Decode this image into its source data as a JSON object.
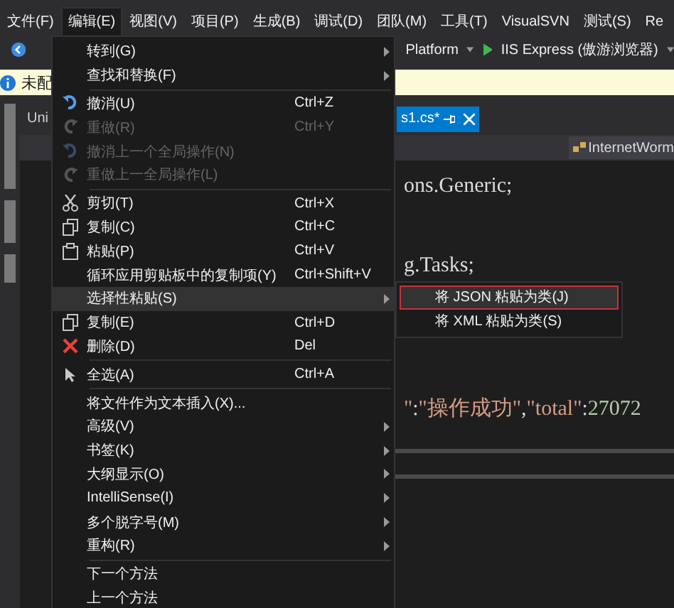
{
  "menu_bar": [
    {
      "label": "文件(F)",
      "selected": false
    },
    {
      "label": "编辑(E)",
      "selected": true
    },
    {
      "label": "视图(V)",
      "selected": false
    },
    {
      "label": "项目(P)",
      "selected": false
    },
    {
      "label": "生成(B)",
      "selected": false
    },
    {
      "label": "调试(D)",
      "selected": false
    },
    {
      "label": "团队(M)",
      "selected": false
    },
    {
      "label": "工具(T)",
      "selected": false
    },
    {
      "label": "VisualSVN",
      "selected": false
    },
    {
      "label": "测试(S)",
      "selected": false
    },
    {
      "label": "Re",
      "selected": false
    }
  ],
  "toolbar": {
    "platform": "Platform",
    "run_target": "IIS Express (傲游浏览器)"
  },
  "info_bar": {
    "text": "未配"
  },
  "tabs": [
    {
      "label": "Uni",
      "selected": false
    },
    {
      "label": "s1.cs*",
      "selected": true
    }
  ],
  "nav_bar": {
    "member": "InternetWorm"
  },
  "code_lines": [
    [
      {
        "kind": "plain",
        "text": "ons.Generic;"
      }
    ],
    [
      {
        "kind": "plain",
        "text": "g.Tasks;"
      }
    ],
    [
      {
        "kind": "string",
        "text": "\""
      },
      {
        "kind": "plain",
        "text": ":"
      },
      {
        "kind": "string",
        "text": "\"操作成功\""
      },
      {
        "kind": "plain",
        "text": ","
      },
      {
        "kind": "string",
        "text": "\"total\""
      },
      {
        "kind": "plain",
        "text": ":"
      },
      {
        "kind": "number",
        "text": "27072"
      }
    ]
  ],
  "edit_menu": [
    {
      "kind": "item",
      "label": "转到(G)",
      "submenu": true,
      "disabled": false,
      "selected": false
    },
    {
      "kind": "item",
      "label": "查找和替换(F)",
      "submenu": true,
      "disabled": false,
      "selected": false
    },
    {
      "kind": "separator"
    },
    {
      "kind": "item",
      "label": "撤消(U)",
      "shortcut": "Ctrl+Z",
      "submenu": false,
      "disabled": false,
      "selected": false
    },
    {
      "kind": "item",
      "label": "重做(R)",
      "shortcut": "Ctrl+Y",
      "submenu": false,
      "disabled": true,
      "selected": false
    },
    {
      "kind": "item",
      "label": "撤消上一个全局操作(N)",
      "submenu": false,
      "disabled": true,
      "selected": false
    },
    {
      "kind": "item",
      "label": "重做上一全局操作(L)",
      "submenu": false,
      "disabled": true,
      "selected": false
    },
    {
      "kind": "separator"
    },
    {
      "kind": "item",
      "label": "剪切(T)",
      "shortcut": "Ctrl+X",
      "submenu": false,
      "disabled": false,
      "selected": false
    },
    {
      "kind": "item",
      "label": "复制(C)",
      "shortcut": "Ctrl+C",
      "submenu": false,
      "disabled": false,
      "selected": false
    },
    {
      "kind": "item",
      "label": "粘贴(P)",
      "shortcut": "Ctrl+V",
      "submenu": false,
      "disabled": false,
      "selected": false
    },
    {
      "kind": "item",
      "label": "循环应用剪贴板中的复制项(Y)",
      "shortcut": "Ctrl+Shift+V",
      "submenu": false,
      "disabled": false,
      "selected": false
    },
    {
      "kind": "item",
      "label": "选择性粘贴(S)",
      "submenu": true,
      "disabled": false,
      "selected": true
    },
    {
      "kind": "item",
      "label": "复制(E)",
      "shortcut": "Ctrl+D",
      "submenu": false,
      "disabled": false,
      "selected": false
    },
    {
      "kind": "item",
      "label": "删除(D)",
      "shortcut": "Del",
      "submenu": false,
      "disabled": false,
      "selected": false
    },
    {
      "kind": "separator"
    },
    {
      "kind": "item",
      "label": "全选(A)",
      "shortcut": "Ctrl+A",
      "submenu": false,
      "disabled": false,
      "selected": false
    },
    {
      "kind": "separator"
    },
    {
      "kind": "item",
      "label": "将文件作为文本插入(X)...",
      "submenu": false,
      "disabled": false,
      "selected": false
    },
    {
      "kind": "item",
      "label": "高级(V)",
      "submenu": true,
      "disabled": false,
      "selected": false
    },
    {
      "kind": "item",
      "label": "书签(K)",
      "submenu": true,
      "disabled": false,
      "selected": false
    },
    {
      "kind": "item",
      "label": "大纲显示(O)",
      "submenu": true,
      "disabled": false,
      "selected": false
    },
    {
      "kind": "item",
      "label": "IntelliSense(I)",
      "submenu": true,
      "disabled": false,
      "selected": false
    },
    {
      "kind": "item",
      "label": "多个脱字号(M)",
      "submenu": true,
      "disabled": false,
      "selected": false
    },
    {
      "kind": "item",
      "label": "重构(R)",
      "submenu": true,
      "disabled": false,
      "selected": false
    },
    {
      "kind": "separator"
    },
    {
      "kind": "item",
      "label": "下一个方法",
      "submenu": false,
      "disabled": false,
      "selected": false
    },
    {
      "kind": "item",
      "label": "上一个方法",
      "submenu": false,
      "disabled": false,
      "selected": false
    }
  ],
  "paste_special_menu": [
    {
      "label": "将 JSON 粘贴为类(J)",
      "selected": true
    },
    {
      "label": "将 XML 粘贴为类(S)",
      "selected": false
    }
  ]
}
